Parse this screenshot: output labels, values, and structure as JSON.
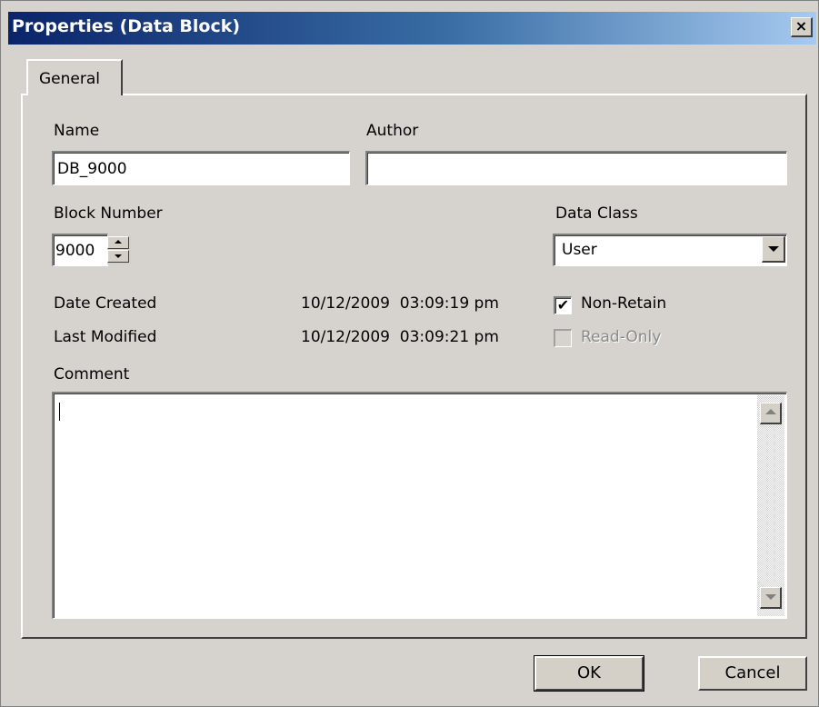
{
  "window": {
    "title": "Properties (Data Block)",
    "close_glyph": "×"
  },
  "tabs": [
    {
      "label": "General",
      "selected": true
    }
  ],
  "general": {
    "name_label": "Name",
    "name_value": "DB_9000",
    "author_label": "Author",
    "author_value": "",
    "block_number_label": "Block Number",
    "block_number_value": "9000",
    "data_class_label": "Data Class",
    "data_class_value": "User",
    "date_created_label": "Date Created",
    "date_created_value": "10/12/2009  03:09:19 pm",
    "last_modified_label": "Last Modified",
    "last_modified_value": "10/12/2009  03:09:21 pm",
    "non_retain_label": "Non-Retain",
    "non_retain_checked": true,
    "read_only_label": "Read-Only",
    "read_only_checked": false,
    "read_only_enabled": false,
    "comment_label": "Comment",
    "comment_value": ""
  },
  "buttons": {
    "ok_label": "OK",
    "cancel_label": "Cancel"
  },
  "icons": {
    "close": "close-icon",
    "spin_up": "arrow-up-icon",
    "spin_down": "arrow-down-icon",
    "dropdown": "chevron-down-icon",
    "check": "checkmark-icon"
  },
  "colors": {
    "titlebar_start": "#0a246a",
    "titlebar_end": "#a6caf0",
    "dialog_face": "#d6d3ce"
  }
}
